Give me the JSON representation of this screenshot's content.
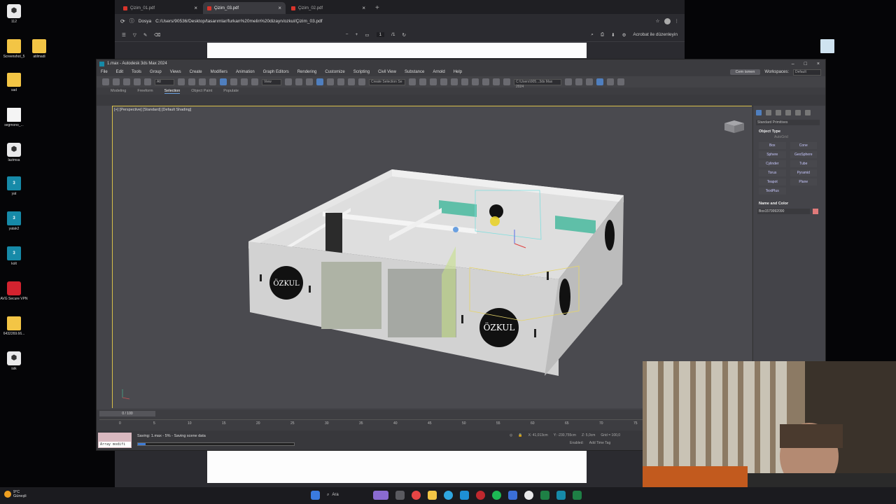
{
  "desktop": {
    "icons": [
      {
        "label": "112",
        "kind": "app"
      },
      {
        "label": "Screenshot_5",
        "kind": "folder"
      },
      {
        "label": "atilmadi",
        "kind": "folder"
      },
      {
        "label": "sad",
        "kind": "folder"
      },
      {
        "label": "segmono_...",
        "kind": "doc"
      },
      {
        "label": "lazimsa",
        "kind": "app"
      },
      {
        "label": "yat",
        "kind": "max"
      },
      {
        "label": "yatak2",
        "kind": "max"
      },
      {
        "label": "kolt",
        "kind": "max"
      },
      {
        "label": "AVG Secure VPN",
        "kind": "avg"
      },
      {
        "label": "6432269.66...",
        "kind": "folder"
      },
      {
        "label": "isik",
        "kind": "app"
      }
    ]
  },
  "browser": {
    "tabs": [
      "Çizim_01.pdf",
      "Çizim_03.pdf",
      "Çizim_02.pdf"
    ],
    "active_tab": 1,
    "address_prefix": "Dosya",
    "url": "C:/Users/90536/Desktop/tasarımlar/furkan%20melin%20dizayn/ozkul/Çizim_03.pdf",
    "page_number": "1",
    "page_total": "/1",
    "edit_button": "Acrobat ile düzenleyin"
  },
  "max": {
    "title": "1.max - Autodesk 3ds Max 2024",
    "menus": [
      "File",
      "Edit",
      "Tools",
      "Group",
      "Views",
      "Create",
      "Modifiers",
      "Animation",
      "Graph Editors",
      "Rendering",
      "Customize",
      "Scripting",
      "Civil View",
      "Substance",
      "Arnold",
      "Help"
    ],
    "user": "Cem ismen",
    "workspace_label": "Workspaces:",
    "workspace": "Default",
    "toolbar": {
      "selection_filter": "All",
      "view_field": "View",
      "named_selection": "Create Selection Se",
      "project_path": "C:\\Users\\905...3ds Max 2024"
    },
    "ribbon_tabs": [
      "Modeling",
      "Freeform",
      "Selection",
      "Object Paint",
      "Populate"
    ],
    "ribbon_selected": 2,
    "viewport_label": "[+] [Perspective] [Standard] [Default Shading]",
    "scene": {
      "brand_text": "ÖZKUL"
    },
    "command_panel": {
      "category": "Standard Primitives",
      "object_type_title": "Object Type",
      "autogrid": "AutoGrid",
      "primitives": [
        "Box",
        "Cone",
        "Sphere",
        "GeoSphere",
        "Cylinder",
        "Tube",
        "Torus",
        "Pyramid",
        "Teapot",
        "Plane",
        "TextPlus"
      ],
      "name_color_title": "Name and Color",
      "object_name": "Box1579992090",
      "object_color": "#e07a7a"
    },
    "timeline": {
      "frame_display": "0 / 100",
      "ticks": [
        "0",
        "5",
        "10",
        "15",
        "20",
        "25",
        "30",
        "35",
        "40",
        "45",
        "50",
        "55",
        "60",
        "65",
        "70",
        "75"
      ]
    },
    "status": {
      "maxscript_label": "Array modifi",
      "message": "Saving: 1.max - 5% - Saving scene data",
      "progress": 0.05,
      "x": "X: 41,013cm",
      "y": "Y: -230,755cm",
      "z": "Z: 5,0cm",
      "grid": "Grid = 100,0",
      "enabled": "Enabled:",
      "add_time_tag": "Add Time Tag"
    }
  },
  "taskbar": {
    "temp": "9°C",
    "weather": "Güneşli",
    "search": "Ara"
  },
  "colors": {
    "selection_yellow": "#d8c04a",
    "accent_blue": "#4f7fbf",
    "wall": "#dcdcdc",
    "turquoise": "#5fbfa8"
  }
}
